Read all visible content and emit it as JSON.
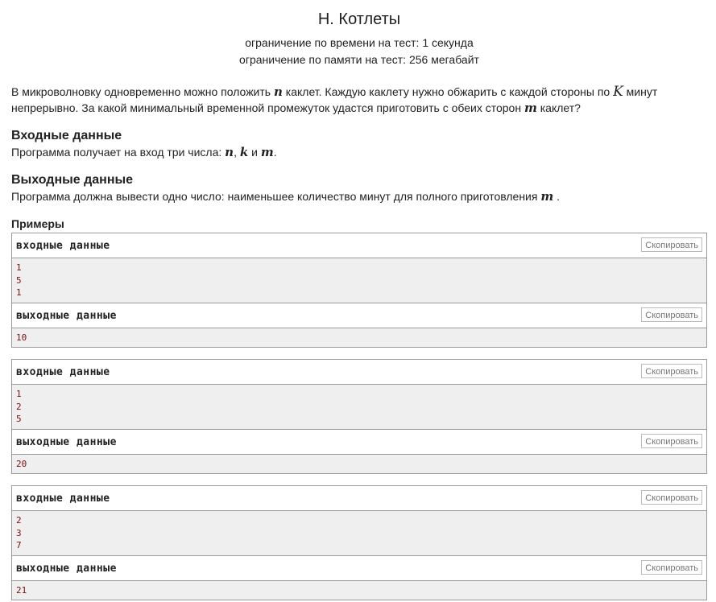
{
  "problem": {
    "title": "H. Котлеты",
    "time_limit": "ограничение по времени на тест: 1 секунда",
    "memory_limit": "ограничение по памяти на тест: 256 мегабайт",
    "legend_p1": "В микроволновку одновременно можно положить ",
    "legend_n": "n",
    "legend_p2": " каклет. Каждую каклету нужно обжарить с каждой стороны по ",
    "legend_K": "K",
    "legend_p3": " минут",
    "legend_p4": "непрерывно. За какой минимальный временной промежуток удастся приготовить с обеих сторон ",
    "legend_m": "m",
    "legend_p5": " каклет?"
  },
  "input_section": {
    "title": "Входные данные",
    "text_p1": "Программа получает на вход три числа: ",
    "v1": "n",
    "sep1": ", ",
    "v2": "k",
    "sep2": " и ",
    "v3": "m",
    "end": "."
  },
  "output_section": {
    "title": "Выходные данные",
    "text_p1": "Программа должна вывести одно число: наименьшее количество минут для полного приготовления ",
    "v1": "m",
    "end": " ."
  },
  "examples": {
    "title": "Примеры",
    "input_label": "входные данные",
    "output_label": "выходные данные",
    "copy_label": "Скопировать",
    "list": [
      {
        "input": [
          "1",
          "5",
          "1"
        ],
        "output": [
          "10"
        ]
      },
      {
        "input": [
          "1",
          "2",
          "5"
        ],
        "output": [
          "20"
        ]
      },
      {
        "input": [
          "2",
          "3",
          "7"
        ],
        "output": [
          "21"
        ]
      }
    ]
  }
}
